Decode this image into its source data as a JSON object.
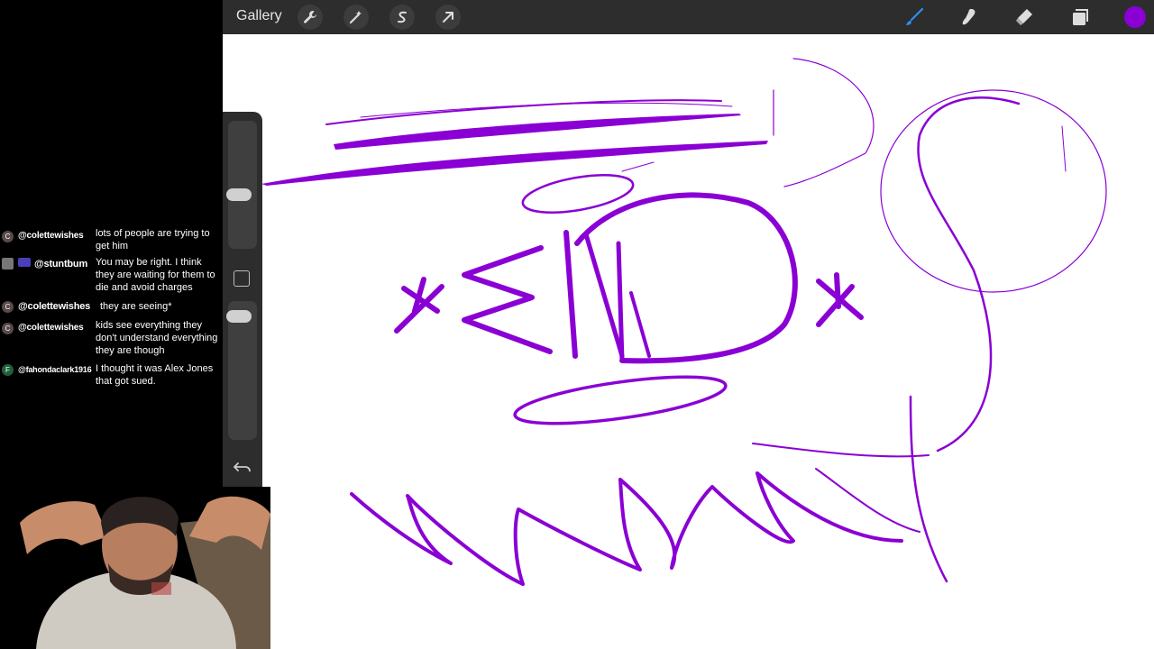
{
  "toolbar": {
    "gallery_label": "Gallery",
    "left_tools": [
      "wrench-icon",
      "magic-wand-icon",
      "selection-icon",
      "transform-arrow-icon"
    ],
    "right_tools": [
      "brush-icon",
      "smudge-icon",
      "eraser-icon",
      "layers-icon"
    ],
    "active_color": "#8a00d4"
  },
  "sidebar": {
    "brush_size": 0.32,
    "brush_opacity": 0.06
  },
  "chat": {
    "messages": [
      {
        "avatar": "C",
        "avatar_color": "#5a4a4a",
        "user": "@colettewishes",
        "text": "lots of people are trying to get him"
      },
      {
        "avatar": "",
        "avatar_color": "#777777",
        "user": "@stuntbum",
        "text": "You may be right. I think they are waiting for them to die and avoid charges"
      },
      {
        "avatar": "C",
        "avatar_color": "#5a4a4a",
        "user": "@colettewishes",
        "text": "they are seeing*"
      },
      {
        "avatar": "C",
        "avatar_color": "#5a4a4a",
        "user": "@colettewishes",
        "text": "kids see everything they don't understand everything they are though"
      },
      {
        "avatar": "F",
        "avatar_color": "#1f5f3a",
        "user": "@fahondaclark1916",
        "text": "I thought it was Alex Jones that got sued."
      }
    ]
  },
  "canvas": {
    "stroke_color": "#8a00d4"
  }
}
